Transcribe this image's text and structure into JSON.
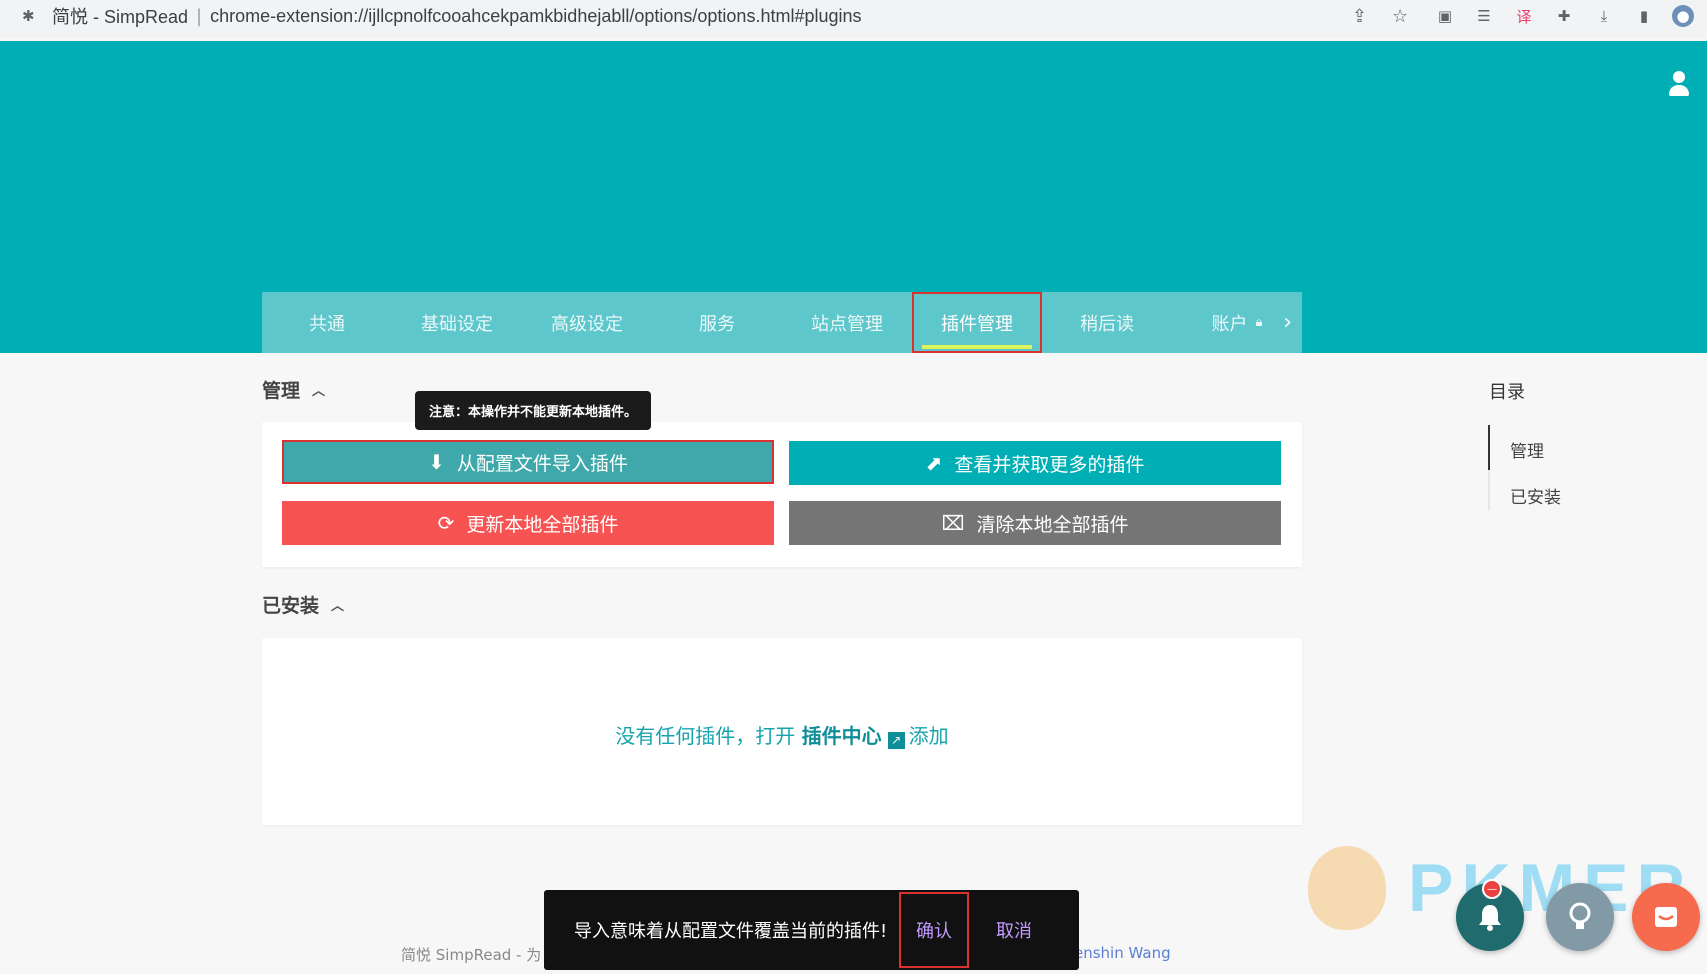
{
  "browser": {
    "site_name": "简悦 - SimpRead",
    "url": "chrome-extension://ijllcpnolfcooahcekpamkbidhejabll/options/options.html#plugins"
  },
  "tabs": [
    {
      "label": "共通"
    },
    {
      "label": "基础设定"
    },
    {
      "label": "高级设定"
    },
    {
      "label": "服务"
    },
    {
      "label": "站点管理"
    },
    {
      "label": "插件管理"
    },
    {
      "label": "稍后读"
    },
    {
      "label": "账户"
    }
  ],
  "manage": {
    "title": "管理",
    "tooltip": "注意：本操作并不能更新本地插件。",
    "import_label": "从配置文件导入插件",
    "more_label": "查看并获取更多的插件",
    "update_label": "更新本地全部插件",
    "clear_label": "清除本地全部插件"
  },
  "installed": {
    "title": "已安装",
    "empty_prefix": "没有任何插件，打开",
    "empty_link": "插件中心",
    "empty_suffix": "添加"
  },
  "toc": {
    "title": "目录",
    "items": [
      "管理",
      "已安装"
    ]
  },
  "footer": {
    "left": "简悦 SimpRead - 为",
    "right": "enshin Wang"
  },
  "snackbar": {
    "message": "导入意味着从配置文件覆盖当前的插件!",
    "confirm": "确认",
    "cancel": "取消"
  },
  "watermark": "PKMER",
  "colors": {
    "brand": "#00afb5",
    "tabbar": "#5ec7cc",
    "danger": "#f85353",
    "neutral": "#757575",
    "highlight_border": "#d9322f"
  }
}
